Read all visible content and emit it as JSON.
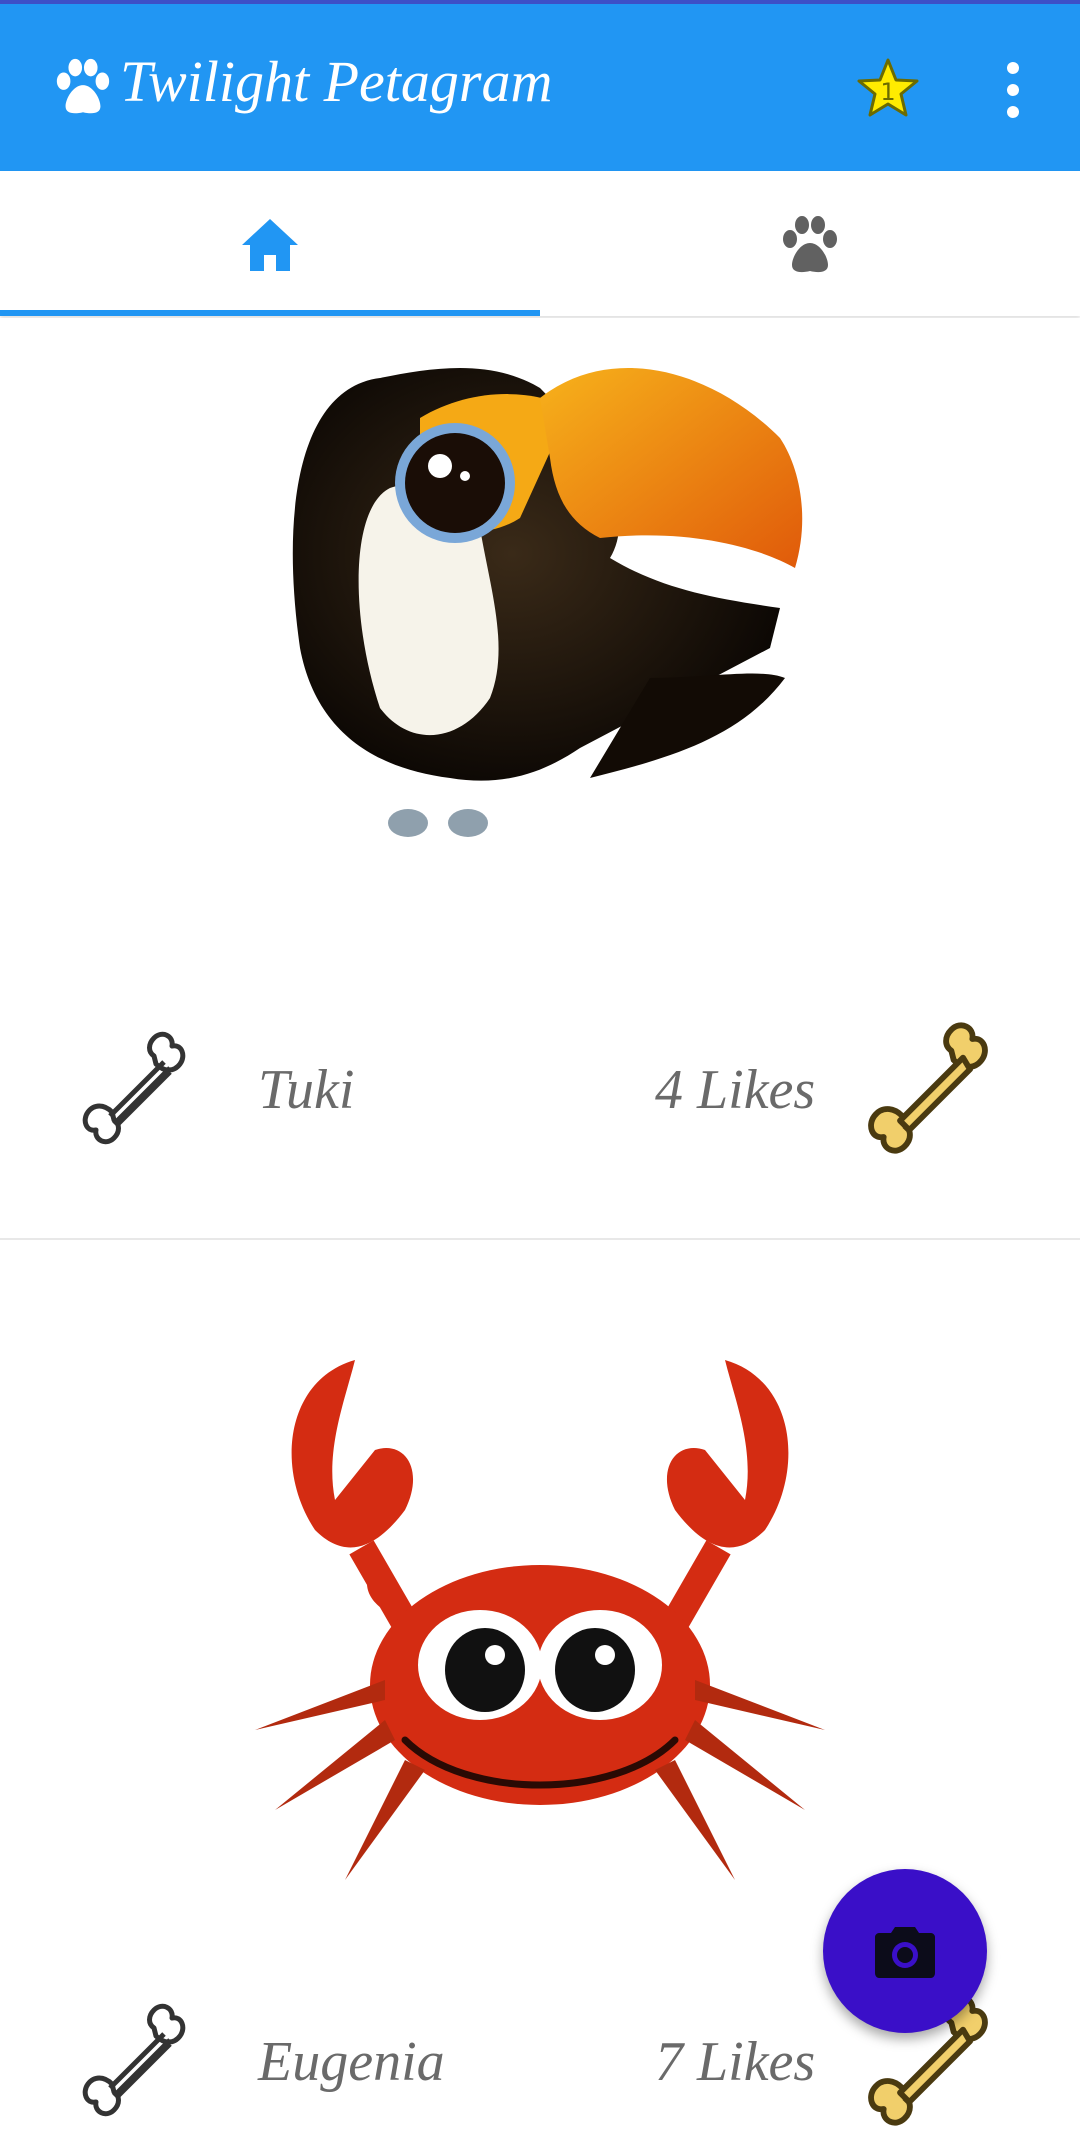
{
  "app": {
    "title": "Twilight Petagram",
    "icons": [
      "paw-icon",
      "star-icon",
      "more-vert-icon"
    ],
    "colors": {
      "primary": "#2196F3",
      "accent": "#3a0fc8",
      "star": "#FFEB00"
    }
  },
  "tabs": [
    {
      "icon": "home-icon",
      "selected": true
    },
    {
      "icon": "paw-icon",
      "selected": false
    }
  ],
  "pets": [
    {
      "name": "Tuki",
      "likes_label": "4 Likes",
      "image": "toucan"
    },
    {
      "name": "Eugenia",
      "likes_label": "7 Likes",
      "image": "crab"
    }
  ],
  "fab": {
    "icon": "camera-icon"
  }
}
